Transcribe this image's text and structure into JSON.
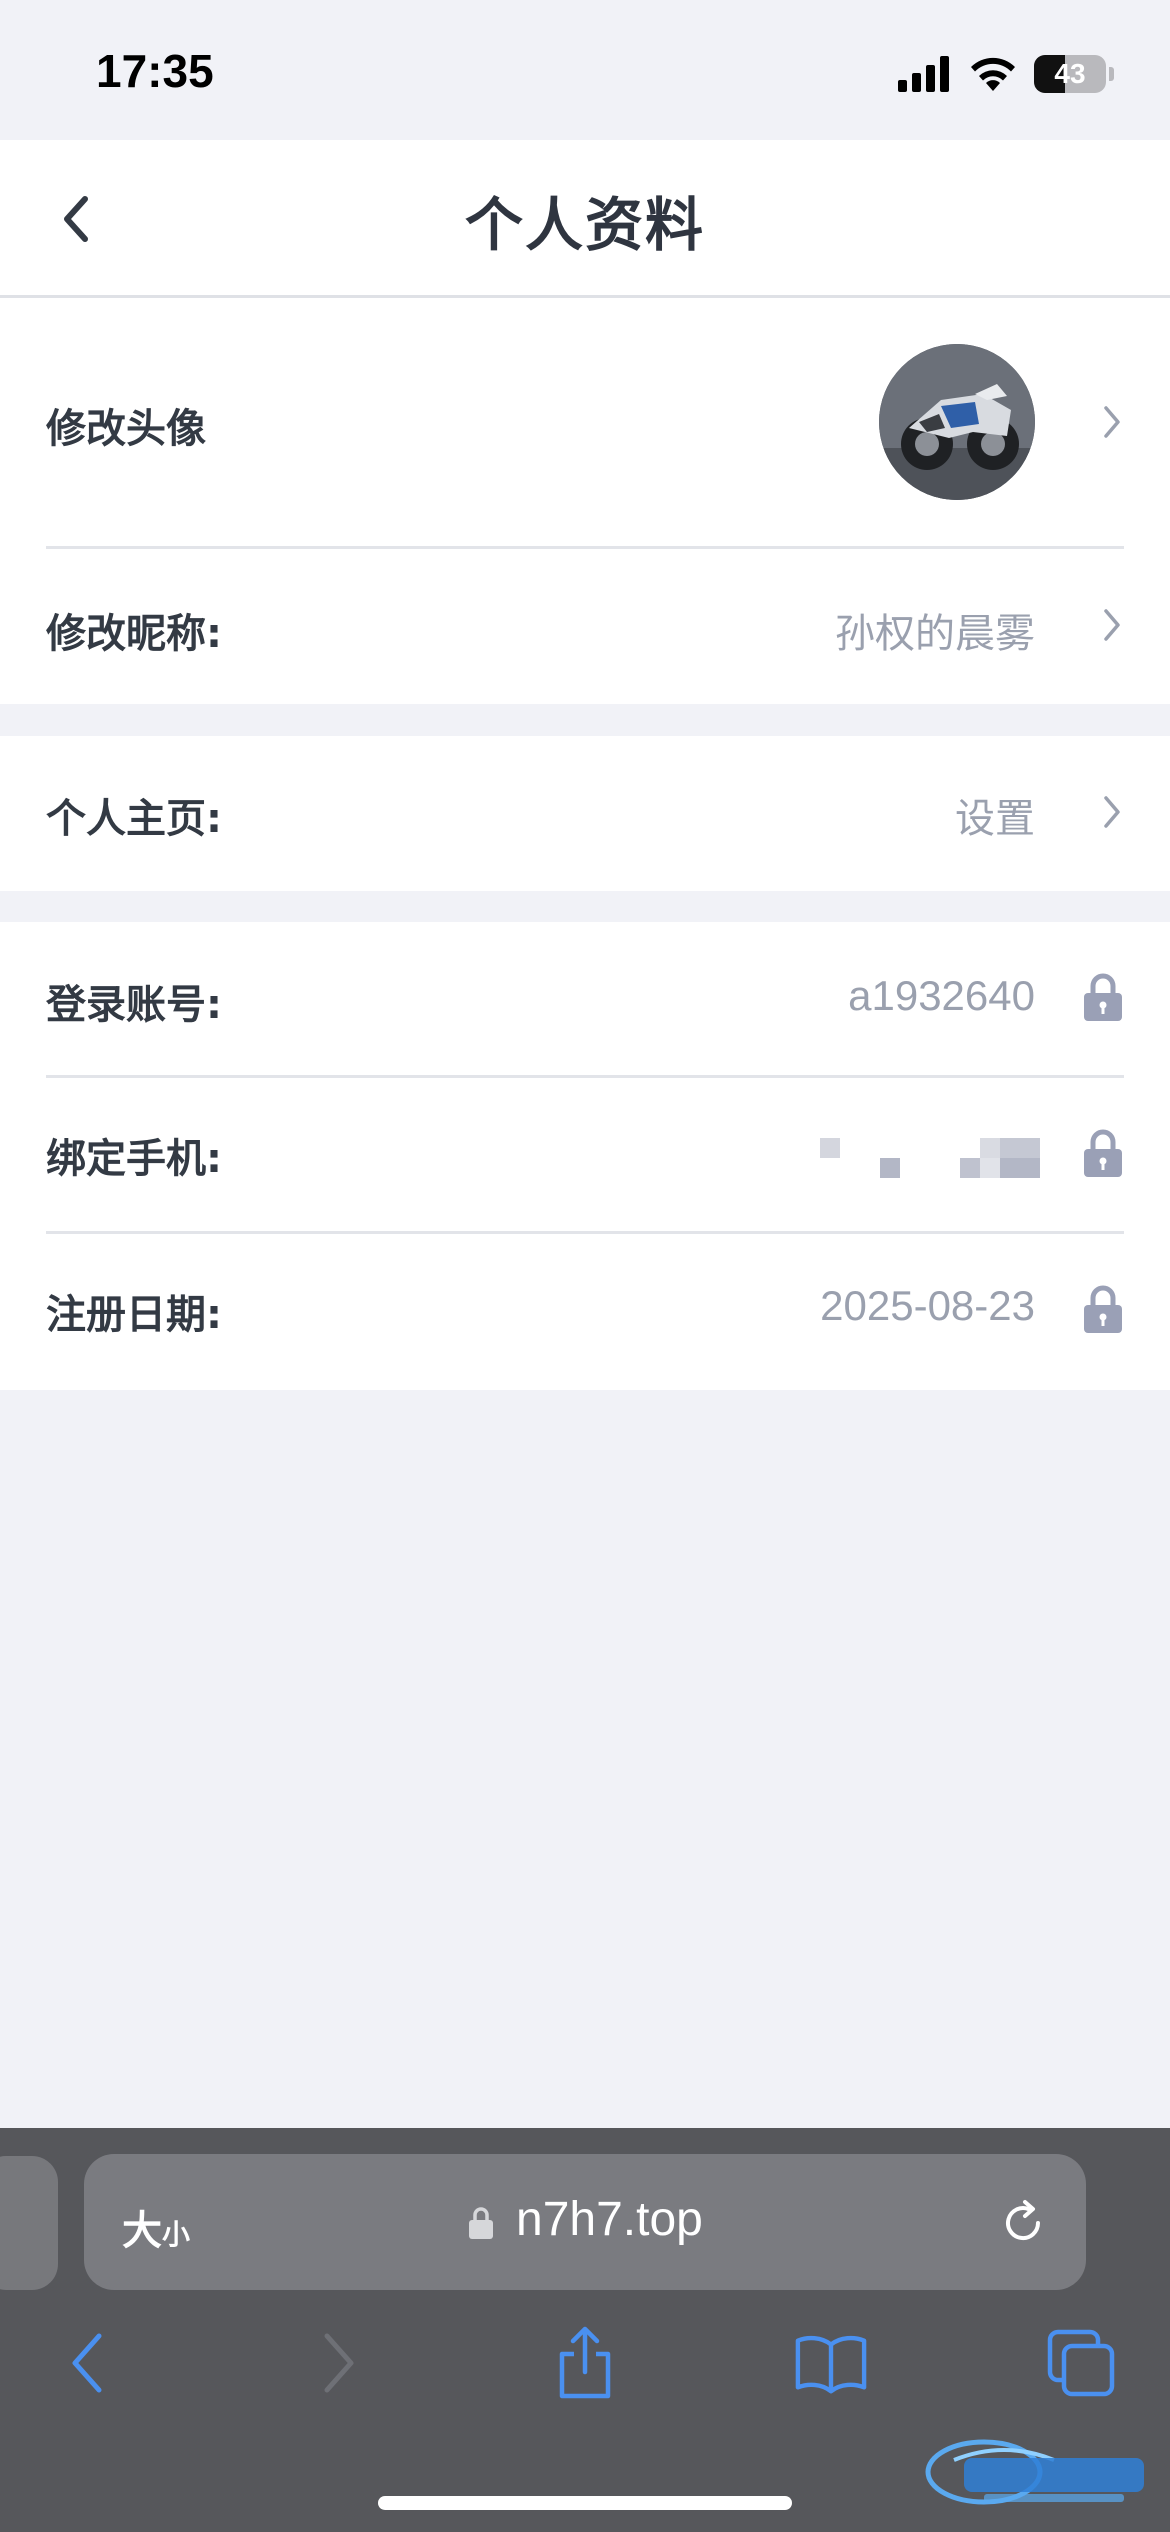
{
  "status_bar": {
    "time": "17:35",
    "battery_level": "43",
    "icons": [
      "cellular-signal-icon",
      "wifi-icon",
      "battery-icon"
    ]
  },
  "header": {
    "title": "个人资料",
    "back_icon": "chevron-left-icon"
  },
  "profile": {
    "avatar_label": "修改头像",
    "nickname_label": "修改昵称:",
    "nickname_value": "孙权的晨雾"
  },
  "homepage": {
    "label": "个人主页:",
    "value": "设置"
  },
  "account": {
    "login_label": "登录账号:",
    "login_value": "a1932640",
    "phone_label": "绑定手机:",
    "phone_value_masked": true,
    "register_label": "注册日期:",
    "register_value": "2025-08-23"
  },
  "browser": {
    "text_size_big": "大",
    "text_size_small": "小",
    "url": "n7h7.top",
    "toolbar_icons": [
      "back-icon",
      "forward-icon",
      "share-icon",
      "bookmarks-icon",
      "tabs-icon"
    ]
  },
  "colors": {
    "accent_blue": "#4a90f0",
    "page_bg": "#f1f2f7",
    "value_gray": "#9aa0ae",
    "lock_color": "#9aa0b6"
  }
}
